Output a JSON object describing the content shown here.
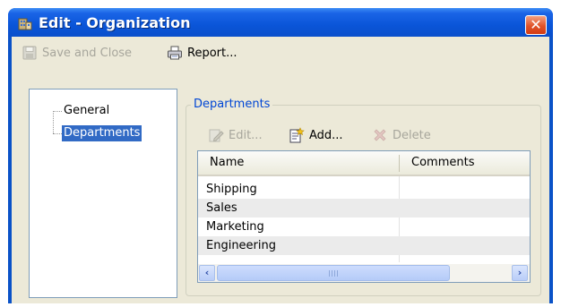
{
  "window": {
    "title": "Edit - Organization",
    "close_glyph": "✕"
  },
  "toolbar": {
    "save_close_label": "Save and Close",
    "report_label": "Report..."
  },
  "tree": {
    "items": [
      {
        "label": "General",
        "selected": false
      },
      {
        "label": "Departments",
        "selected": true
      }
    ]
  },
  "departments": {
    "group_label": "Departments",
    "edit_label": "Edit...",
    "add_label": "Add...",
    "delete_label": "Delete",
    "columns": [
      "Name",
      "Comments"
    ],
    "rows": [
      {
        "name": "Shipping",
        "comments": ""
      },
      {
        "name": "Sales",
        "comments": ""
      },
      {
        "name": "Marketing",
        "comments": ""
      },
      {
        "name": "Engineering",
        "comments": ""
      }
    ]
  },
  "icons": {
    "title": "organization-icon",
    "save": "floppy-disk-icon",
    "report": "printer-icon",
    "edit": "pencil-icon",
    "add": "add-document-icon",
    "delete": "red-x-icon",
    "scroll_left": "‹",
    "scroll_right": "›"
  },
  "colors": {
    "titlebar": "#0a55d8",
    "client": "#ece9d8",
    "selection": "#316ac5",
    "group_label": "#0046d5",
    "disabled_text": "#a7a69c",
    "close_button": "#e0532a"
  }
}
